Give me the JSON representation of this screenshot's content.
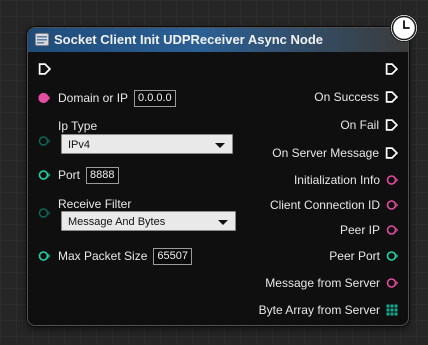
{
  "node": {
    "title": "Socket Client Init UDPReceiver Async Node",
    "colors": {
      "exec": "#ffffff",
      "string_pin": "#e64ca0",
      "byte_pin": "#17a58f",
      "header_blue": "#2b6095"
    },
    "icons": {
      "header": "function-icon",
      "latent": "clock-icon"
    },
    "inputs": {
      "domain": {
        "label": "Domain or IP",
        "value": "0.0.0.0"
      },
      "ip_type": {
        "label": "Ip Type",
        "value": "IPv4"
      },
      "port": {
        "label": "Port",
        "value": "8888"
      },
      "receive_filter": {
        "label": "Receive Filter",
        "value": "Message And Bytes"
      },
      "max_packet_size": {
        "label": "Max Packet Size",
        "value": "65507"
      }
    },
    "outputs": {
      "on_success": "On Success",
      "on_fail": "On Fail",
      "on_server_message": "On Server Message",
      "initialization_info": "Initialization Info",
      "client_connection_id": "Client Connection ID",
      "peer_ip": "Peer IP",
      "peer_port": "Peer Port",
      "message_from_server": "Message from Server",
      "byte_array_from_server": "Byte Array from Server"
    }
  }
}
